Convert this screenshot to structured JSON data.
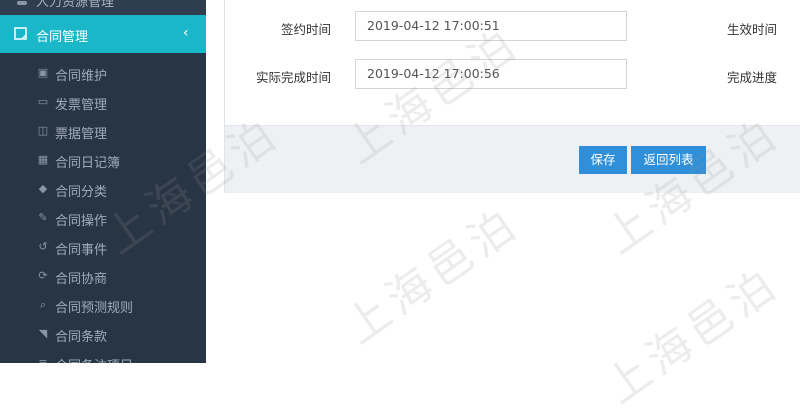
{
  "sidebar": {
    "top_item": {
      "label": "人力资源管理",
      "icon": "user-icon"
    },
    "active_item": {
      "label": "合同管理",
      "icon": "contract-icon",
      "chevron": "‹"
    },
    "sub_items": [
      {
        "label": "合同维护",
        "icon": "file-edit-icon",
        "glyph": "▣"
      },
      {
        "label": "发票管理",
        "icon": "invoice-icon",
        "glyph": "▭"
      },
      {
        "label": "票据管理",
        "icon": "book-icon",
        "glyph": "◫"
      },
      {
        "label": "合同日记簿",
        "icon": "calendar-icon",
        "glyph": "▦"
      },
      {
        "label": "合同分类",
        "icon": "cubes-icon",
        "glyph": "◆"
      },
      {
        "label": "合同操作",
        "icon": "wrench-icon",
        "glyph": "✎"
      },
      {
        "label": "合同事件",
        "icon": "history-icon",
        "glyph": "↺"
      },
      {
        "label": "合同协商",
        "icon": "refresh-icon",
        "glyph": "⟳"
      },
      {
        "label": "合同预测规则",
        "icon": "search-icon",
        "glyph": "⌕"
      },
      {
        "label": "合同条款",
        "icon": "tag-icon",
        "glyph": "◥"
      },
      {
        "label": "合同备注项目",
        "icon": "list-icon",
        "glyph": "≡"
      }
    ]
  },
  "form": {
    "sign_time_label": "签约时间",
    "sign_time_value": "2019-04-12 17:00:51",
    "effective_time_label": "生效时间",
    "actual_complete_label": "实际完成时间",
    "actual_complete_value": "2019-04-12 17:00:56",
    "progress_label": "完成进度"
  },
  "buttons": {
    "save": "保存",
    "back": "返回列表"
  },
  "watermark": "上海邑泊",
  "colors": {
    "sidebar_bg": "#2f3e4e",
    "active_bg": "#1ab7c8",
    "button_bg": "#2f8fd8"
  }
}
